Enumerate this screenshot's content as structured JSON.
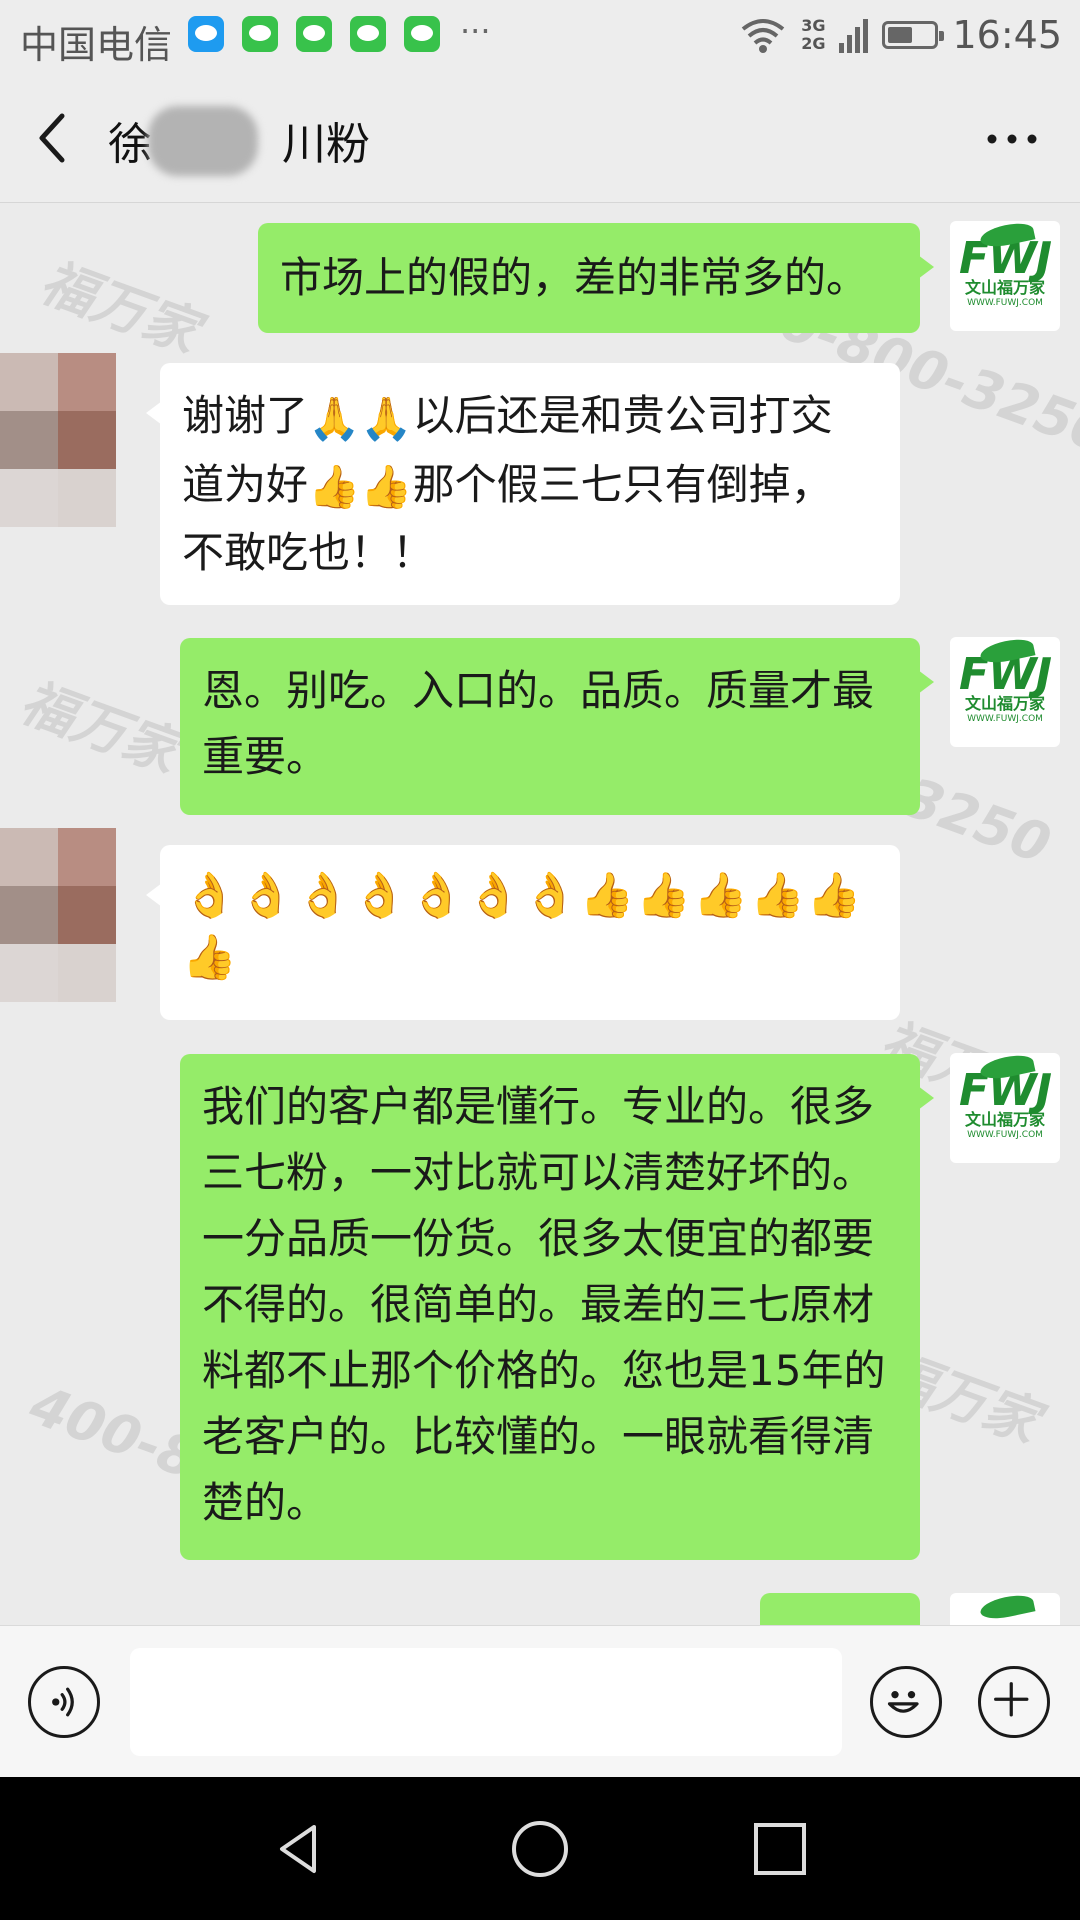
{
  "status_bar": {
    "carrier": "中国电信",
    "more": "···",
    "network_top": "3G",
    "network_bottom": "2G",
    "time": "16:45"
  },
  "header": {
    "title_visible_start": "徐",
    "title_visible_end": "川粉"
  },
  "watermark": {
    "phone": "400-800-3250",
    "brand": "福万家"
  },
  "avatar_me": {
    "brand": "FWJ",
    "subtitle": "文山福万家",
    "url": "WWW.FUWJ.COM"
  },
  "messages": [
    {
      "side": "me",
      "text": "市场上的假的，差的非常多的。"
    },
    {
      "side": "them",
      "line1_a": "谢谢了",
      "line1_b": "以后还是和贵公司打交",
      "line2_a": "道为好",
      "line2_b": "那个假三七只有倒掉，",
      "line3": "不敢吃也！！",
      "emoji_pray": "🙏",
      "emoji_thumb": "👍"
    },
    {
      "side": "me",
      "text": "恩。别吃。入口的。品质。质量才最重要。"
    },
    {
      "side": "them",
      "emoji_ok": "👌",
      "emoji_thumb": "👍",
      "ok_count": 7,
      "thumb_count": 6
    },
    {
      "side": "me",
      "text": "我们的客户都是懂行。专业的。很多三七粉，一对比就可以清楚好坏的。一分品质一份货。很多太便宜的都要不得的。很简单的。最差的三七原材料都不止那个价格的。您也是15年的老客户的。比较懂的。一眼就看得清楚的。"
    }
  ],
  "input_bar": {
    "placeholder": ""
  },
  "colors": {
    "my_bubble": "#95ec69",
    "their_bubble": "#ffffff",
    "background": "#ebebeb",
    "brand_green": "#1f8c2f"
  }
}
